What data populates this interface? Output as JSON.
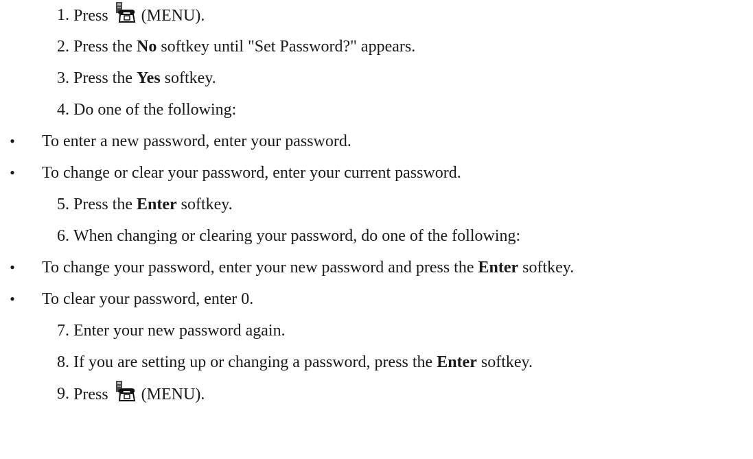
{
  "steps": [
    {
      "num": "1.",
      "pre": "Press ",
      "icon": "phone-menu-icon",
      "post": " (MENU)."
    },
    {
      "num": "2.",
      "pre": "Press the ",
      "bold": "No",
      "post": " softkey until \"Set Password?\" appears."
    },
    {
      "num": "3.",
      "pre": "Press the ",
      "bold": "Yes",
      "post": " softkey."
    },
    {
      "num": "4.",
      "pre": "Do one of the following:"
    },
    {
      "bullet": "•",
      "pre": "To enter a new password, enter your password."
    },
    {
      "bullet": "•",
      "pre": "To change or clear your password, enter your current password."
    },
    {
      "num": "5.",
      "pre": "Press the ",
      "bold": "Enter",
      "post": " softkey."
    },
    {
      "num": "6.",
      "pre": "When changing or clearing your password, do one of the following:"
    },
    {
      "bullet": "•",
      "pre": "To change your password, enter your new password and press the ",
      "bold": "Enter",
      "post": " softkey."
    },
    {
      "bullet": "•",
      "pre": "To clear your password, enter 0."
    },
    {
      "num": "7.",
      "pre": "Enter your new password again."
    },
    {
      "num": "8.",
      "pre": "If you are setting up or changing a password, press the ",
      "bold": "Enter",
      "post": " softkey."
    },
    {
      "num": "9.",
      "pre": "Press ",
      "icon": "phone-menu-icon",
      "post": " (MENU)."
    }
  ]
}
